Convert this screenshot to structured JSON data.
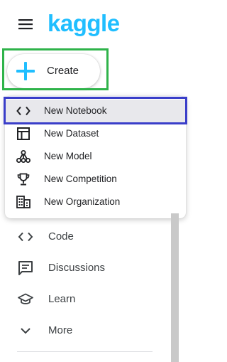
{
  "header": {
    "menu_icon": "hamburger-menu-icon",
    "logo_text": "kaggle",
    "logo_color": "#20beff"
  },
  "create_button": {
    "label": "Create",
    "icon": "plus-icon",
    "icon_color": "#20beff"
  },
  "create_menu": {
    "items": [
      {
        "label": "New Notebook",
        "icon": "code-brackets-icon",
        "selected": true
      },
      {
        "label": "New Dataset",
        "icon": "table-icon",
        "selected": false
      },
      {
        "label": "New Model",
        "icon": "model-nodes-icon",
        "selected": false
      },
      {
        "label": "New Competition",
        "icon": "trophy-icon",
        "selected": false
      },
      {
        "label": "New Organization",
        "icon": "building-icon",
        "selected": false
      }
    ]
  },
  "sidebar": {
    "items": [
      {
        "label": "Code",
        "icon": "code-brackets-icon"
      },
      {
        "label": "Discussions",
        "icon": "chat-icon"
      },
      {
        "label": "Learn",
        "icon": "graduation-cap-icon"
      },
      {
        "label": "More",
        "icon": "chevron-down-icon"
      }
    ]
  },
  "annotations": {
    "create_highlight_color": "#2fb34a",
    "notebook_highlight_color": "#3a3ec9"
  }
}
